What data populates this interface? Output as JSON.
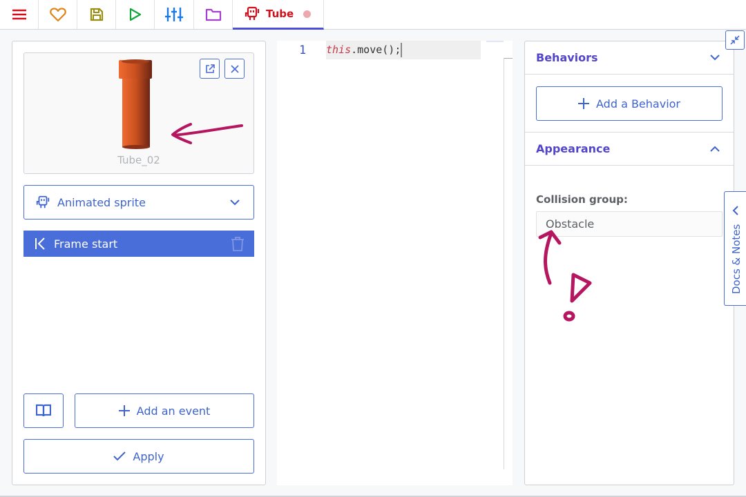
{
  "toolbar": {
    "buttons": [
      {
        "icon": "menu-icon",
        "color": "#d10f1a"
      },
      {
        "icon": "heart-icon",
        "color": "#e08418"
      },
      {
        "icon": "save-icon",
        "color": "#9a8d12"
      },
      {
        "icon": "play-icon",
        "color": "#12a53c"
      },
      {
        "icon": "sliders-icon",
        "color": "#1679e8"
      },
      {
        "icon": "folder-icon",
        "color": "#a33ed0"
      }
    ],
    "active_tab": {
      "label": "Tube",
      "icon": "robot-sprite-icon",
      "color": "#d10f1a",
      "unsaved": true
    }
  },
  "left_panel": {
    "preview": {
      "name": "Tube_02",
      "open_external_icon": "external-link-icon",
      "close_icon": "close-icon"
    },
    "object_type": {
      "label": "Animated sprite",
      "icon": "robot-sprite-icon"
    },
    "events": [
      {
        "label": "Frame start",
        "icon": "frame-start-icon",
        "delete_icon": "trash-icon"
      }
    ],
    "docs_button_icon": "book-icon",
    "add_event_label": "Add an event",
    "apply_label": "Apply"
  },
  "editor": {
    "lines": [
      {
        "number": "1",
        "keyword": "this",
        "rest": ".move();"
      }
    ]
  },
  "right_panel": {
    "behaviors": {
      "title": "Behaviors",
      "expanded": false,
      "add_label": "Add a Behavior"
    },
    "appearance": {
      "title": "Appearance",
      "expanded": true,
      "collision_label": "Collision group:",
      "collision_value": "Obstacle"
    }
  },
  "docs_tab": {
    "label": "Docs & Notes"
  },
  "colors": {
    "accent": "#4a6ed9",
    "heading": "#5245c9",
    "annotation": "#b5165f"
  }
}
